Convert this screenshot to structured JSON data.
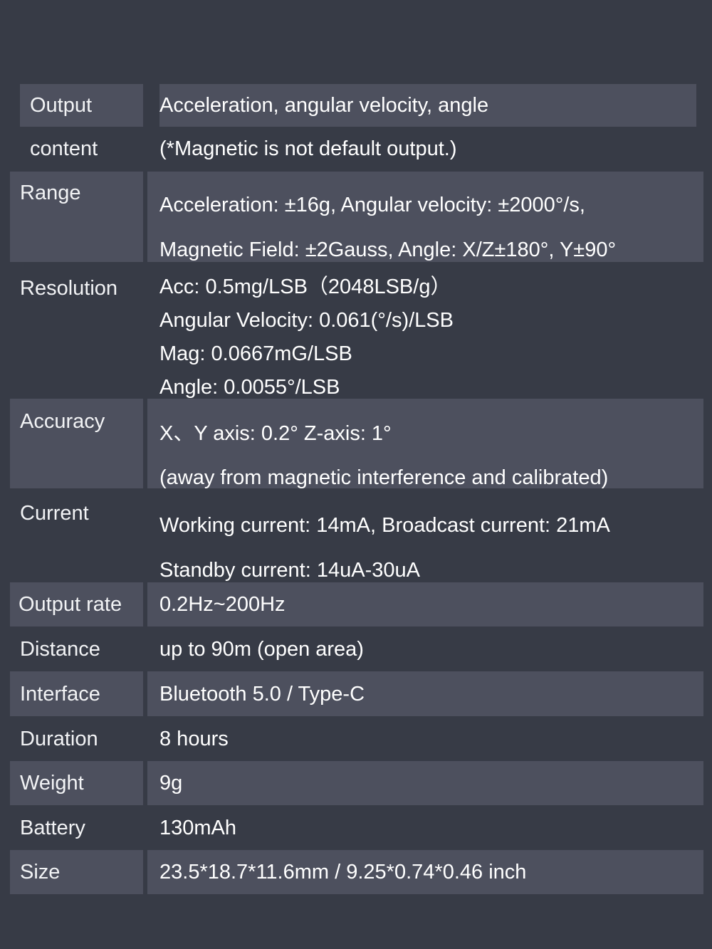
{
  "table": {
    "rows": [
      {
        "label_line_1": "Output",
        "label_line_2": "content",
        "value_line_1": "Acceleration, angular velocity, angle",
        "value_line_2": "(*Magnetic is not default output.)"
      },
      {
        "label": "Range",
        "value_line_1": "Acceleration: ±16g, Angular velocity: ±2000°/s,",
        "value_line_2": "Magnetic Field: ±2Gauss, Angle: X/Z±180°, Y±90°"
      },
      {
        "label": "Resolution",
        "value_line_1": "Acc: 0.5mg/LSB（2048LSB/g）",
        "value_line_2": "Angular Velocity: 0.061(°/s)/LSB",
        "value_line_3": "Mag: 0.0667mG/LSB",
        "value_line_4": "Angle: 0.0055°/LSB"
      },
      {
        "label": "Accuracy",
        "value_line_1": "X、Y axis: 0.2°    Z-axis: 1°",
        "value_line_2": "(away from magnetic interference and calibrated)"
      },
      {
        "label": "Current",
        "value_line_1": "Working current: 14mA, Broadcast current: 21mA",
        "value_line_2": "Standby current: 14uA-30uA"
      },
      {
        "label": "Output rate",
        "value": "0.2Hz~200Hz"
      },
      {
        "label": "Distance",
        "value": "up to 90m (open area)"
      },
      {
        "label": "Interface",
        "value": "Bluetooth 5.0 / Type-C"
      },
      {
        "label": "Duration",
        "value": "8 hours"
      },
      {
        "label": "Weight",
        "value": "9g"
      },
      {
        "label": "Battery",
        "value": "130mAh"
      },
      {
        "label": "Size",
        "value": "23.5*18.7*11.6mm / 9.25*0.74*0.46 inch"
      }
    ]
  },
  "colors": {
    "background": "#373b46",
    "row_light": "#4d505e",
    "row_dark": "#373b46",
    "text": "#ffffff"
  }
}
